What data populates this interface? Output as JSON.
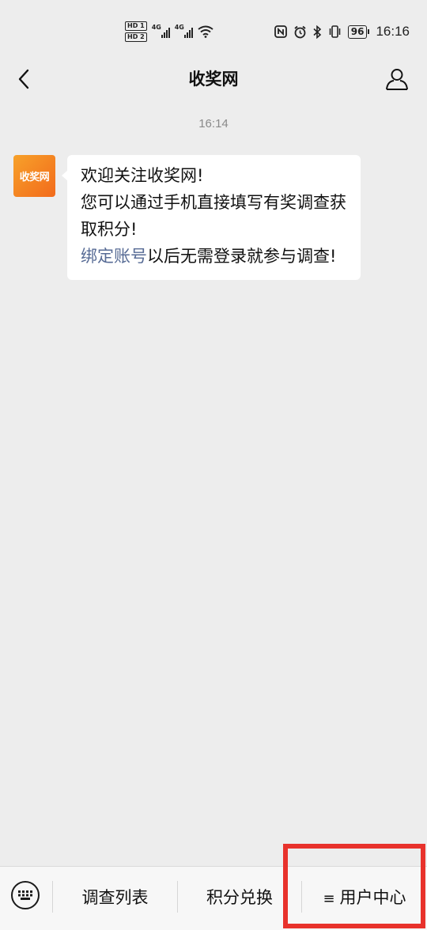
{
  "status_bar": {
    "hd_badges": [
      "HD 1",
      "HD 2"
    ],
    "signal_labels": [
      "4G",
      "4G"
    ],
    "battery": "96",
    "time": "16:16"
  },
  "header": {
    "title": "收奖网"
  },
  "chat": {
    "timestamp": "16:14",
    "avatar_text": "收奖网",
    "message": {
      "line1": "欢迎关注收奖网!",
      "line2": "您可以通过手机直接填写有奖调查获取积分!",
      "link": "绑定账号",
      "line3_rest": "以后无需登录就参与调查!"
    },
    "colors": {
      "link": "#576b95",
      "avatar_bg": "#f58220"
    }
  },
  "bottom_menu": {
    "items": [
      {
        "label": "调查列表"
      },
      {
        "label": "积分兑换"
      },
      {
        "label": "用户中心",
        "icon": "menu-lines-icon"
      }
    ],
    "highlight_color": "#e8322c"
  }
}
